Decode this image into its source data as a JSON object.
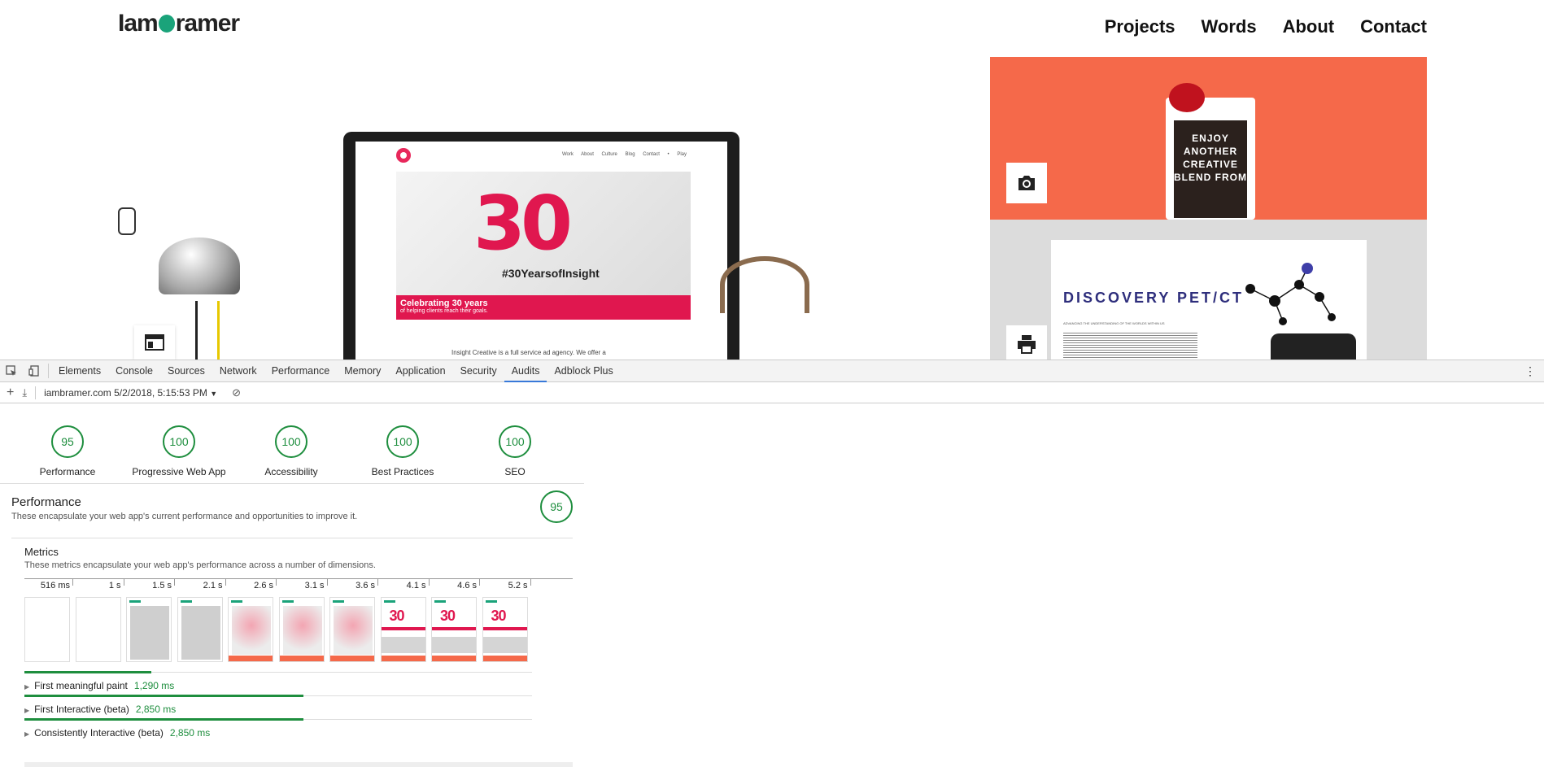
{
  "site": {
    "logo": "IamBramer",
    "logo_left": "Iam",
    "logo_right": "ramer",
    "nav": [
      "Projects",
      "Words",
      "About",
      "Contact"
    ],
    "monitor": {
      "nav": "Work About Culture Blog Contact • Play",
      "big": "30",
      "hashtag": "#30YearsofInsight",
      "band_title": "Celebrating 30 years",
      "band_sub": "of helping clients reach their goals.",
      "footer": "Insight Creative is a full service ad agency. We offer a"
    },
    "bag_text": "ENJOY ANOTHER CREATIVE BLEND FROM",
    "poster_title": "DISCOVERY PET/CT",
    "poster_sub": "ADVANCING THE UNDERSTANDING OF THE WORLDS WITHIN US",
    "colors": {
      "accent": "#f5694a",
      "brand_pink": "#e0174f",
      "logo_green": "#1aa37a"
    }
  },
  "devtools": {
    "tabs": [
      "Elements",
      "Console",
      "Sources",
      "Network",
      "Performance",
      "Memory",
      "Application",
      "Security",
      "Audits",
      "Adblock Plus"
    ],
    "active_tab": "Audits",
    "report_select": "iambramer.com 5/2/2018, 5:15:53 PM",
    "gauges": [
      {
        "score": "95",
        "label": "Performance"
      },
      {
        "score": "100",
        "label": "Progressive Web App"
      },
      {
        "score": "100",
        "label": "Accessibility"
      },
      {
        "score": "100",
        "label": "Best Practices"
      },
      {
        "score": "100",
        "label": "SEO"
      }
    ],
    "performance": {
      "title": "Performance",
      "desc": "These encapsulate your web app's current performance and opportunities to improve it.",
      "score": "95"
    },
    "metrics": {
      "title": "Metrics",
      "desc": "These metrics encapsulate your web app's performance across a number of dimensions.",
      "filmstrip": [
        "516 ms",
        "1 s",
        "1.5 s",
        "2.1 s",
        "2.6 s",
        "3.1 s",
        "3.6 s",
        "4.1 s",
        "4.6 s",
        "5.2 s"
      ],
      "rows": [
        {
          "label": "First meaningful paint",
          "value": "1,290 ms",
          "fraction": 0.25
        },
        {
          "label": "First Interactive (beta)",
          "value": "2,850 ms",
          "fraction": 0.55
        },
        {
          "label": "Consistently Interactive (beta)",
          "value": "2,850 ms",
          "fraction": 0.55
        }
      ]
    }
  }
}
